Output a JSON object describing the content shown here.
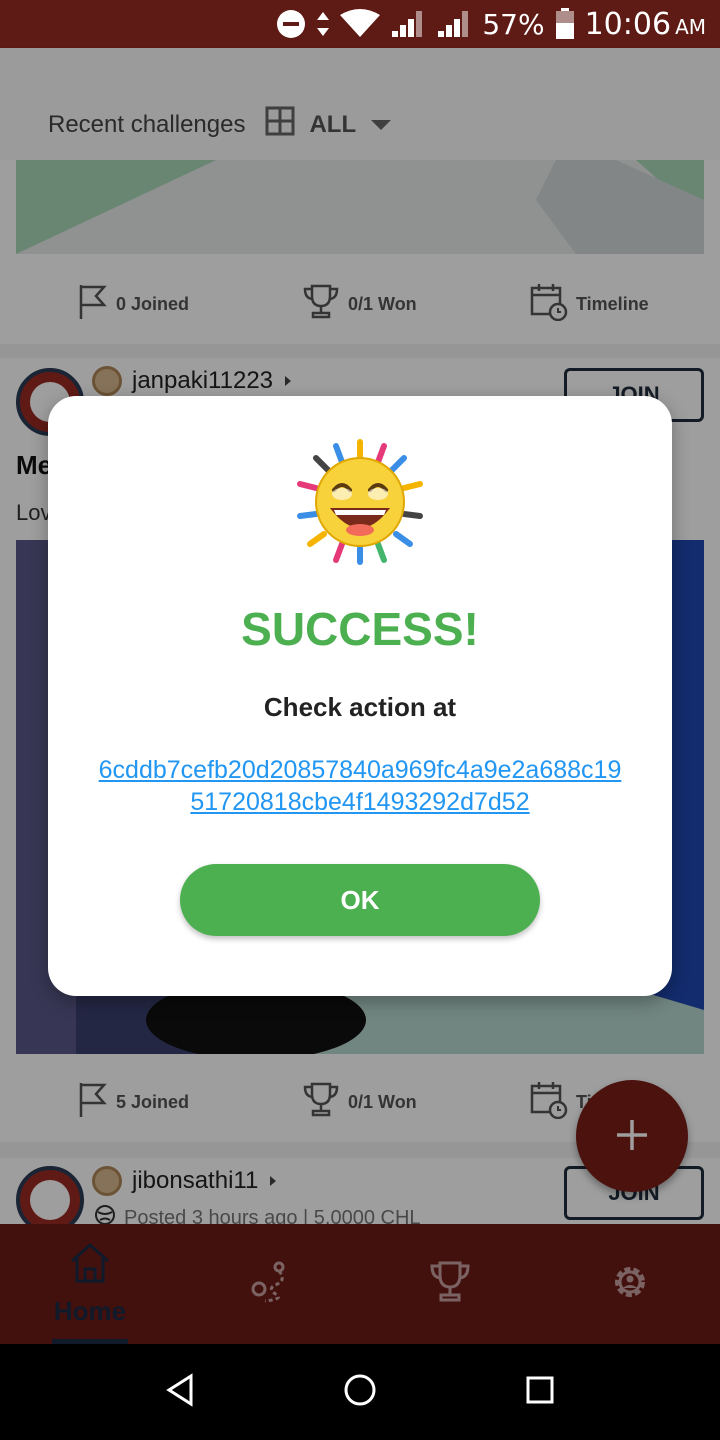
{
  "status_bar": {
    "battery": "57%",
    "time": "10:06",
    "ampm": "AM"
  },
  "header": {
    "title": "Recent challenges",
    "filter": "ALL"
  },
  "cards": [
    {
      "joined": "0 Joined",
      "won": "0/1 Won",
      "timeline": "Timeline"
    },
    {
      "user": "janpaki11223",
      "join_label": "JOIN",
      "title_partial": "Me",
      "desc_partial": "Lov",
      "joined": "5 Joined",
      "won": "0/1 Won",
      "timeline_partial": "Ti"
    },
    {
      "user": "jibonsathi11",
      "meta": "Posted 3 hours ago | 5.0000 CHL",
      "join_label": "JOIN"
    }
  ],
  "bottom_nav": {
    "home_label": "Home"
  },
  "modal": {
    "title": "SUCCESS!",
    "message": "Check action at",
    "hash": "6cddb7cefb20d20857840a969fc4a9e2a688c1951720818cbe4f1493292d7d52",
    "ok_label": "OK"
  },
  "colors": {
    "brand": "#6b1b15",
    "success": "#4caf50",
    "link": "#2196f3"
  }
}
